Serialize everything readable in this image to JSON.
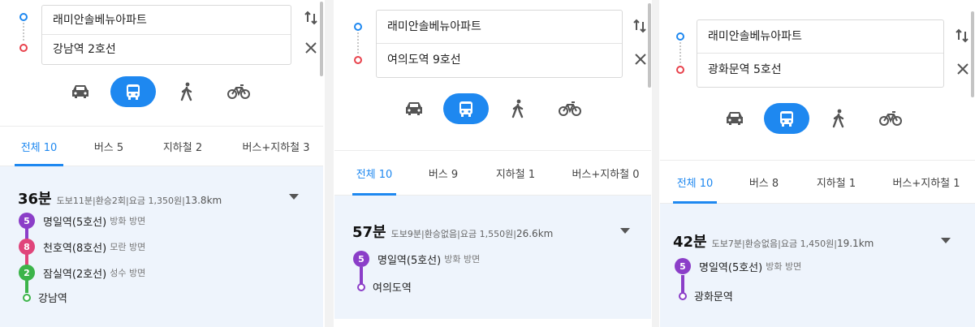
{
  "panels": [
    {
      "origin": "래미안솔베뉴아파트",
      "destination": "강남역 2호선",
      "tabs": [
        "전체 10",
        "버스 5",
        "지하철 2",
        "버스+지하철 3"
      ],
      "summary": {
        "duration": "36분",
        "walk": "도보11분",
        "transfer": "환승2회",
        "fare": "요금 1,350원",
        "distance": "13.8km"
      },
      "stops": [
        {
          "badge": "5",
          "name": "명일역(5호선)",
          "direction": "방화 방면"
        },
        {
          "badge": "8",
          "name": "천호역(8호선)",
          "direction": "모란 방면"
        },
        {
          "badge": "2",
          "name": "잠실역(2호선)",
          "direction": "성수 방면"
        },
        {
          "badge": "",
          "name": "강남역",
          "direction": ""
        }
      ]
    },
    {
      "origin": "래미안솔베뉴아파트",
      "destination": "여의도역 9호선",
      "tabs": [
        "전체 10",
        "버스 9",
        "지하철 1",
        "버스+지하철 0"
      ],
      "summary": {
        "duration": "57분",
        "walk": "도보9분",
        "transfer": "환승없음",
        "fare": "요금 1,550원",
        "distance": "26.6km"
      },
      "stops": [
        {
          "badge": "5",
          "name": "명일역(5호선)",
          "direction": "방화 방면"
        },
        {
          "badge": "",
          "name": "여의도역",
          "direction": ""
        }
      ]
    },
    {
      "origin": "래미안솔베뉴아파트",
      "destination": "광화문역 5호선",
      "tabs": [
        "전체 10",
        "버스 8",
        "지하철 1",
        "버스+지하철 1"
      ],
      "summary": {
        "duration": "42분",
        "walk": "도보7분",
        "transfer": "환승없음",
        "fare": "요금 1,450원",
        "distance": "19.1km"
      },
      "stops": [
        {
          "badge": "5",
          "name": "명일역(5호선)",
          "direction": "방화 방면"
        },
        {
          "badge": "",
          "name": "광화문역",
          "direction": ""
        }
      ]
    }
  ],
  "icons": {
    "swap": "swap-vertical-icon",
    "clear": "close-icon",
    "car": "car-icon",
    "bus": "bus-icon",
    "walk": "walk-icon",
    "bike": "bike-icon",
    "expand": "caret-down-icon"
  },
  "colors": {
    "accent": "#1e88f0",
    "line5": "#8b3ec8",
    "line8": "#e0457b",
    "line2": "#3cb44a",
    "result_bg": "#eef4fc",
    "origin_dot": "#1e88f0",
    "destination_dot": "#e8424c"
  }
}
